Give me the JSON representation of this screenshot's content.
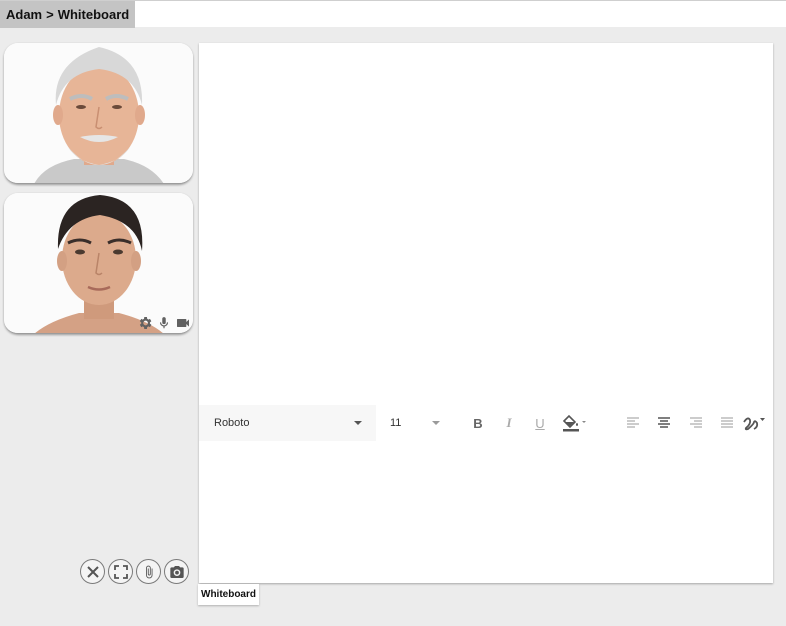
{
  "breadcrumb": {
    "user": "Adam",
    "separator": ">",
    "page": "Whiteboard"
  },
  "participants": [
    {
      "avatar": "older-man-face"
    },
    {
      "avatar": "young-man-face",
      "controls": [
        "gear-icon",
        "microphone-icon",
        "video-camera-icon"
      ]
    }
  ],
  "call_controls": [
    "close-icon",
    "fullscreen-icon",
    "paperclip-icon",
    "camera-icon"
  ],
  "toolbar": {
    "font_family": "Roboto",
    "font_size": "11",
    "bold_label": "B",
    "italic_label": "I",
    "underline_label": "U"
  },
  "tabs": {
    "active": "Whiteboard"
  },
  "colors": {
    "background": "#ececec",
    "breadcrumb_bg": "#c4c4c4",
    "board": "#ffffff",
    "icon": "#616161"
  }
}
